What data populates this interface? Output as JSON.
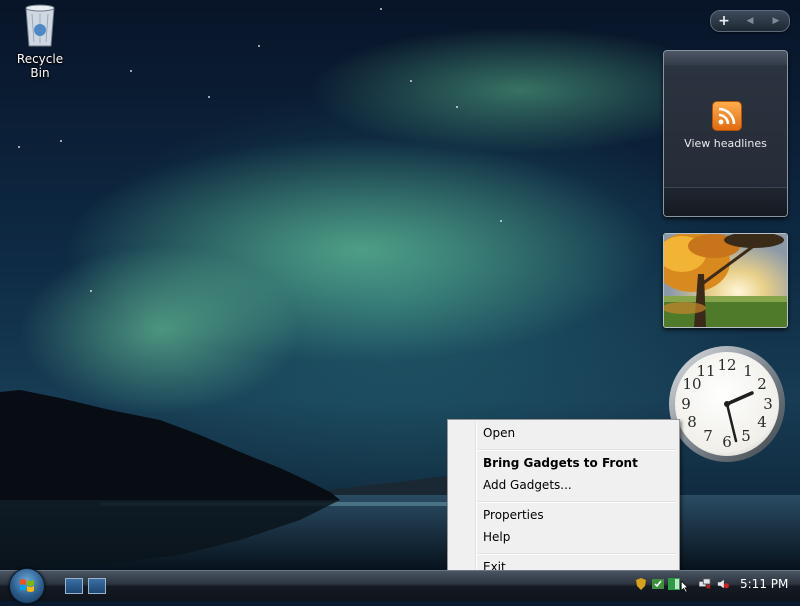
{
  "desktop": {
    "recycle_bin_label": "Recycle Bin"
  },
  "sidebar": {
    "add_gadget_symbol": "+",
    "prev_symbol": "◀",
    "next_symbol": "▶"
  },
  "gadgets": {
    "feed_headlines": {
      "label": "View headlines",
      "icon": "rss-icon"
    },
    "slideshow": {
      "icon": "photo-slideshow"
    },
    "clock": {
      "numbers": [
        "12",
        "1",
        "2",
        "3",
        "4",
        "5",
        "6",
        "7",
        "8",
        "9",
        "10",
        "11"
      ]
    }
  },
  "context_menu": {
    "items": [
      {
        "label": "Open",
        "bold": false
      },
      {
        "label": "Bring Gadgets to Front",
        "bold": true
      },
      {
        "label": "Add Gadgets...",
        "bold": false
      },
      {
        "label": "Properties",
        "bold": false
      },
      {
        "label": "Help",
        "bold": false
      },
      {
        "label": "Exit",
        "bold": false
      }
    ]
  },
  "taskbar": {
    "clock": "5:11 PM"
  },
  "colors": {
    "aurora": "#7de6aa",
    "menu_bg": "#f0f0f0",
    "taskbar_dark": "#151b23"
  }
}
